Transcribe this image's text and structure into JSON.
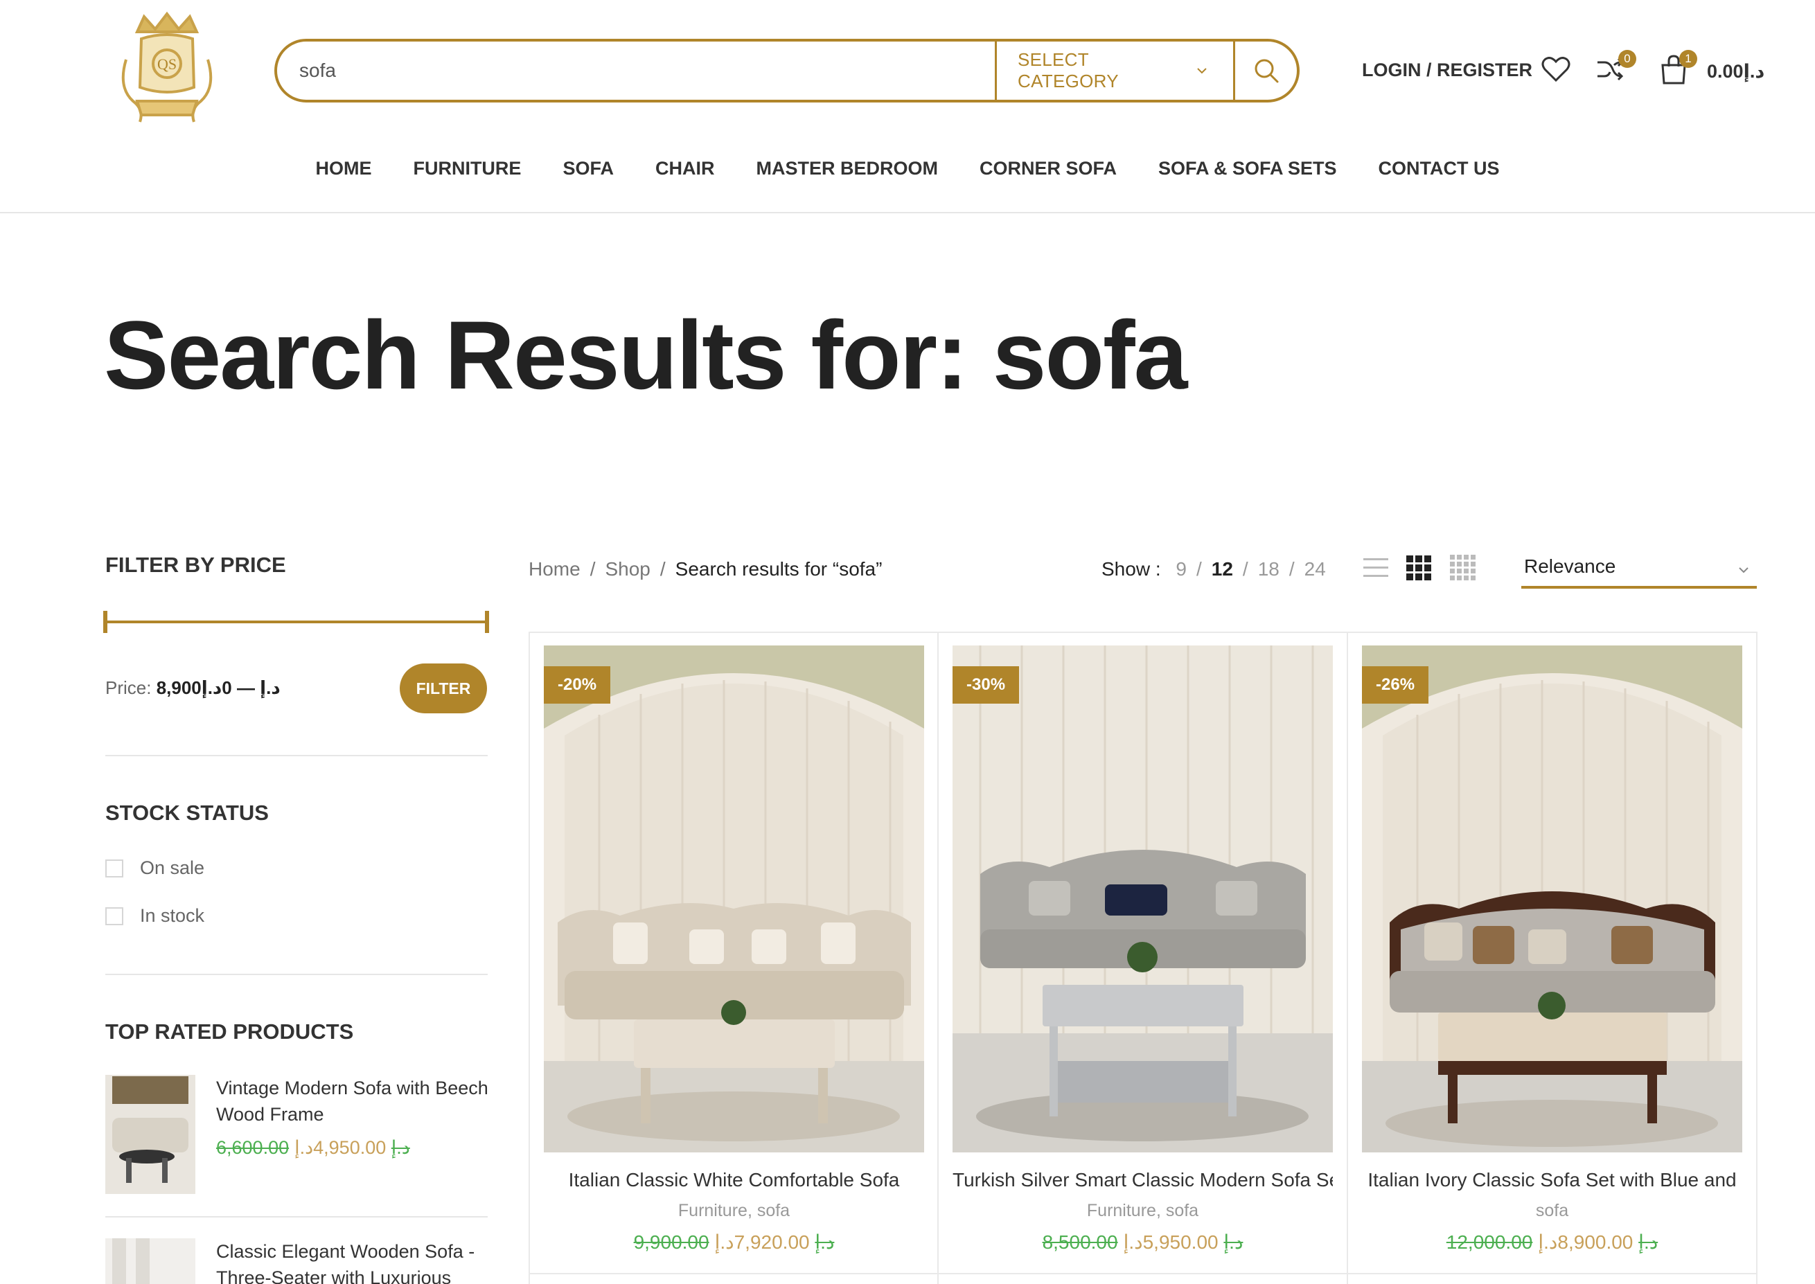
{
  "header": {
    "search": {
      "value": "sofa",
      "category": "SELECT CATEGORY"
    },
    "login": "LOGIN / REGISTER",
    "compare_count": "0",
    "cart_count": "1",
    "cart_total": "0.00د.إ"
  },
  "nav": [
    "HOME",
    "FURNITURE",
    "SOFA",
    "CHAIR",
    "MASTER BEDROOM",
    "CORNER SOFA",
    "SOFA & SOFA SETS",
    "CONTACT US"
  ],
  "page_title": "Search Results for: sofa",
  "sidebar": {
    "filter_title": "FILTER BY PRICE",
    "price_label": "Price:",
    "price_range": "8,900د.إ — 0د.إ",
    "filter_button": "FILTER",
    "stock_title": "STOCK STATUS",
    "stock_options": [
      "On sale",
      "In stock"
    ],
    "top_rated_title": "TOP RATED PRODUCTS",
    "top_rated": [
      {
        "name": "Vintage Modern Sofa with Beech Wood Frame",
        "old_price": "6,600.00د.إ",
        "price": "4,950.00د.إ"
      },
      {
        "name": "Classic Elegant Wooden Sofa - Three-Seater with Luxurious",
        "old_price": "",
        "price": ""
      }
    ]
  },
  "toolbar": {
    "breadcrumb": [
      "Home",
      "Shop",
      "Search results for “sofa”"
    ],
    "show_label": "Show :",
    "show_options": [
      "9",
      "12",
      "18",
      "24"
    ],
    "show_selected": "12",
    "sort": "Relevance"
  },
  "products": [
    {
      "badge": "-20%",
      "title": "Italian Classic White Comfortable Sofa",
      "cats": "Furniture, sofa",
      "old_price": "9,900.00د.إ",
      "price": "7,920.00د.إ"
    },
    {
      "badge": "-30%",
      "title": "Turkish Silver Smart Classic Modern Sofa Set",
      "cats": "Furniture, sofa",
      "old_price": "8,500.00د.إ",
      "price": "5,950.00د.إ"
    },
    {
      "badge": "-26%",
      "title": "Italian Ivory Classic Sofa Set with Blue and",
      "cats": "sofa",
      "old_price": "12,000.00د.إ",
      "price": "8,900.00د.إ"
    }
  ],
  "colors": {
    "accent": "#b0852a",
    "old_price": "#4caf50",
    "new_price": "#c8a05a"
  }
}
